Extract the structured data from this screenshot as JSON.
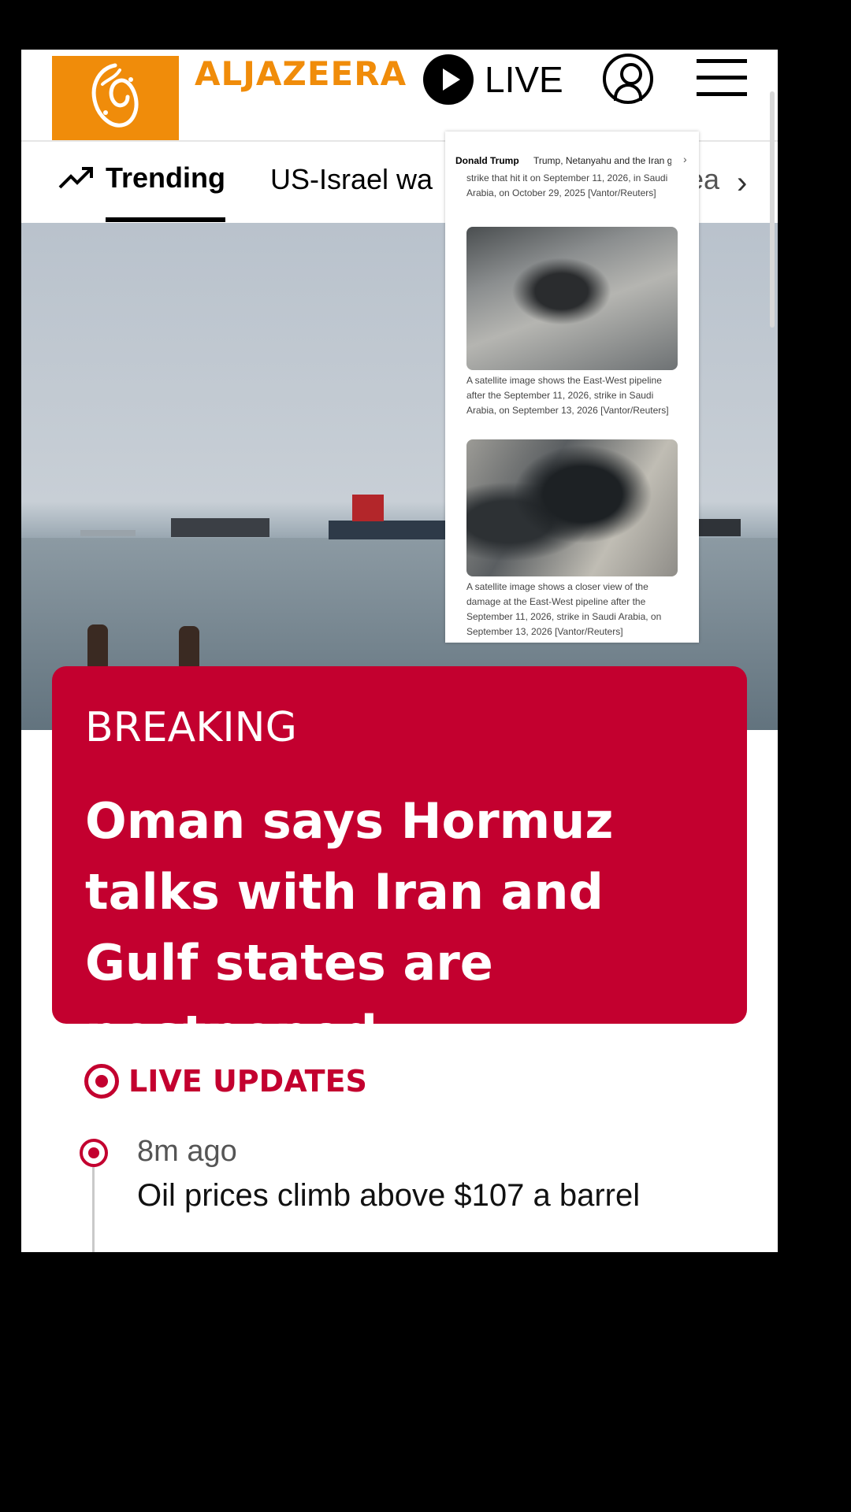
{
  "header": {
    "wordmark": "ALJAZEERA",
    "live_label": "LIVE"
  },
  "trending": {
    "label": "Trending",
    "items": [
      "US-Israel wa",
      "cea"
    ]
  },
  "popup": {
    "tabs": [
      "Donald Trump",
      "Trump, Netanyahu and the Iran g"
    ],
    "captions": [
      "strike that hit it on September 11, 2026, in Saudi Arabia, on October 29, 2025 [Vantor/Reuters]",
      "A satellite image shows the East-West pipeline after the September 11, 2026, strike in Saudi Arabia, on September 13, 2026 [Vantor/Reuters]",
      "A satellite image shows a closer view of the damage at the East-West pipeline after the September 11, 2026, strike in Saudi Arabia, on September 13, 2026 [Vantor/Reuters]"
    ]
  },
  "breaking": {
    "label": "BREAKING",
    "headline": "Oman says Hormuz talks with Iran and Gulf states are postponed"
  },
  "live_updates": {
    "label": "LIVE UPDATES",
    "items": [
      {
        "time": "8m ago",
        "title": "Oil prices climb above $107 a barrel"
      }
    ]
  },
  "colors": {
    "brand_orange": "#f08c0a",
    "breaking_red": "#c3002f"
  }
}
